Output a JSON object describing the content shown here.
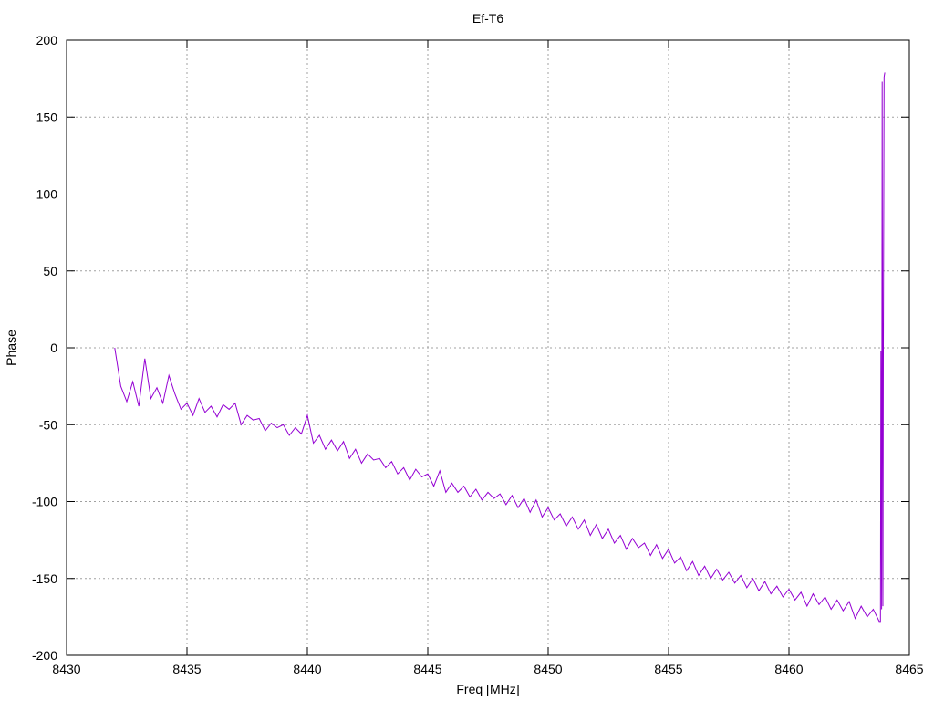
{
  "chart_data": {
    "type": "line",
    "title": "Ef-T6",
    "xlabel": "Freq [MHz]",
    "ylabel": "Phase",
    "xlim": [
      8430,
      8465
    ],
    "ylim": [
      -200,
      200
    ],
    "xticks": [
      8430,
      8435,
      8440,
      8445,
      8450,
      8455,
      8460,
      8465
    ],
    "yticks": [
      -200,
      -150,
      -100,
      -50,
      0,
      50,
      100,
      150,
      200
    ],
    "grid": true,
    "legend": "none",
    "series": [
      {
        "name": "Phase",
        "color": "#9400d3",
        "x_start": 8432,
        "x_step": 0.25,
        "values": [
          0,
          -25,
          -35,
          -22,
          -38,
          -7,
          -33,
          -26,
          -36,
          -18,
          -30,
          -40,
          -36,
          -44,
          -33,
          -42,
          -38,
          -45,
          -37,
          -40,
          -36,
          -50,
          -44,
          -47,
          -46,
          -54,
          -49,
          -52,
          -50,
          -57,
          -52,
          -56,
          -44,
          -62,
          -57,
          -66,
          -60,
          -67,
          -61,
          -72,
          -66,
          -75,
          -69,
          -73,
          -72,
          -78,
          -74,
          -82,
          -78,
          -86,
          -79,
          -84,
          -82,
          -90,
          -80,
          -94,
          -88,
          -94,
          -90,
          -97,
          -92,
          -99,
          -94,
          -98,
          -95,
          -102,
          -96,
          -104,
          -98,
          -107,
          -99,
          -110,
          -104,
          -112,
          -108,
          -116,
          -110,
          -118,
          -112,
          -122,
          -115,
          -124,
          -118,
          -127,
          -122,
          -131,
          -124,
          -130,
          -127,
          -135,
          -128,
          -137,
          -131,
          -140,
          -136,
          -145,
          -139,
          -148,
          -142,
          -150,
          -144,
          -151,
          -146,
          -153,
          -148,
          -156,
          -150,
          -158,
          -152,
          -160,
          -155,
          -162,
          -157,
          -164,
          -159,
          -168,
          -160,
          -167,
          -162,
          -170,
          -164,
          -171,
          -165,
          -176,
          -168,
          -175,
          -170,
          -178
        ],
        "tail_points": [
          [
            8463.8,
            -178
          ],
          [
            8463.82,
            -2
          ],
          [
            8463.85,
            -170
          ],
          [
            8463.87,
            173
          ],
          [
            8463.9,
            -168
          ],
          [
            8463.92,
            0
          ],
          [
            8463.95,
            176
          ],
          [
            8463.98,
            179
          ]
        ]
      }
    ]
  }
}
